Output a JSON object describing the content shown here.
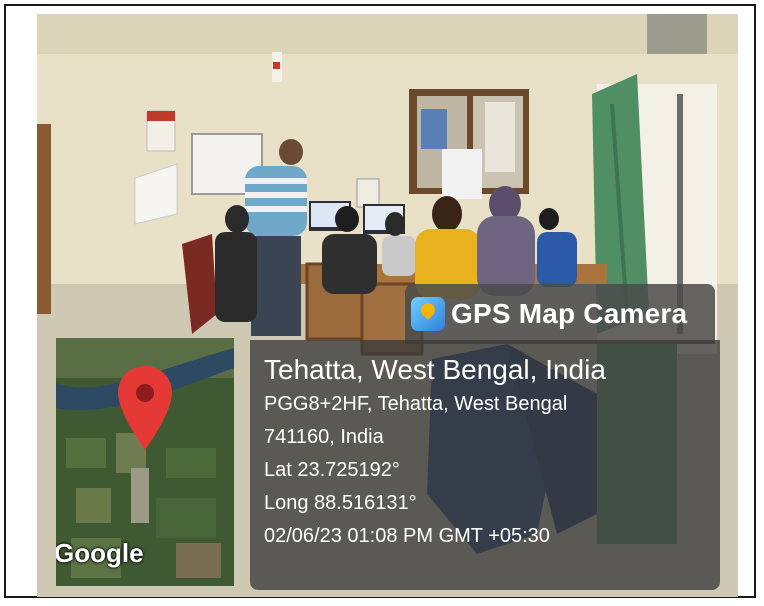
{
  "overlay": {
    "app_name": "GPS Map Camera",
    "app_icon": "gps-map-camera-app-icon",
    "location_title": "Tehatta, West Bengal, India",
    "address_line1": "PGG8+2HF, Tehatta, West Bengal",
    "address_line2": "741160, India",
    "latitude": "Lat 23.725192°",
    "longitude": "Long 88.516131°",
    "datetime": "02/06/23 01:08 PM GMT +05:30"
  },
  "map": {
    "attribution": "Google",
    "pin_color": "#e53935"
  },
  "colors": {
    "overlay_bg": "#3a3a3a",
    "text": "#ffffff",
    "wall": "#e6dfc6",
    "curtain": "#4f8f63"
  }
}
